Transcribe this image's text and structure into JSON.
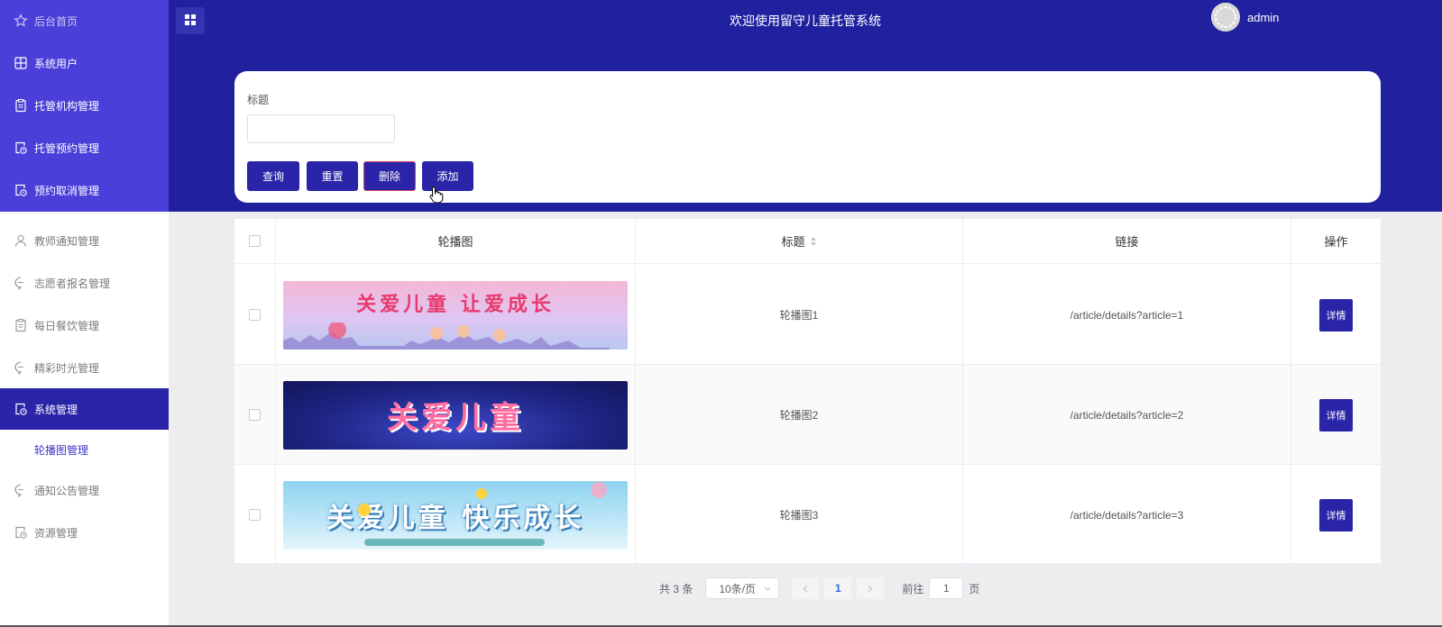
{
  "sidebar": {
    "items": [
      {
        "label": "后台首页",
        "icon": "star-icon"
      },
      {
        "label": "系统用户",
        "icon": "grid-icon"
      },
      {
        "label": "托管机构管理",
        "icon": "clipboard-icon"
      },
      {
        "label": "托管预约管理",
        "icon": "doc-clock-icon"
      },
      {
        "label": "预约取消管理",
        "icon": "doc-clock-icon"
      },
      {
        "label": "教师通知管理",
        "icon": "user-icon"
      },
      {
        "label": "志愿者报名管理",
        "icon": "chat-icon"
      },
      {
        "label": "每日餐饮管理",
        "icon": "clipboard-icon"
      },
      {
        "label": "精彩时光管理",
        "icon": "chat-icon"
      },
      {
        "label": "系统管理",
        "icon": "doc-clock-icon"
      },
      {
        "label": "通知公告管理",
        "icon": "chat-icon"
      },
      {
        "label": "资源管理",
        "icon": "doc-clock-icon"
      }
    ],
    "submenu": {
      "label": "轮播图管理"
    }
  },
  "header": {
    "title": "欢迎使用留守儿童托管系统",
    "username": "admin"
  },
  "search": {
    "label": "标题",
    "value": "",
    "buttons": {
      "query": "查询",
      "reset": "重置",
      "delete": "删除",
      "add": "添加"
    }
  },
  "table": {
    "columns": {
      "image": "轮播图",
      "title": "标题",
      "link": "链接",
      "action": "操作"
    },
    "rows": [
      {
        "title": "轮播图1",
        "link": "/article/details?article=1",
        "action": "详情",
        "banner_text": "关爱儿童 让爱成长"
      },
      {
        "title": "轮播图2",
        "link": "/article/details?article=2",
        "action": "详情",
        "banner_text": "关爱儿童"
      },
      {
        "title": "轮播图3",
        "link": "/article/details?article=3",
        "action": "详情",
        "banner_text": "关爱儿童 快乐成长"
      }
    ]
  },
  "pagination": {
    "total": "共 3 条",
    "page_size": "10条/页",
    "current_page": "1",
    "goto_label": "前往",
    "goto_value": "1",
    "page_suffix": "页"
  },
  "colors": {
    "sidebar_top": "#4a3fd8",
    "header": "#2121a0",
    "primary": "#2a24a8",
    "submenu_active": "#3d35c9"
  }
}
